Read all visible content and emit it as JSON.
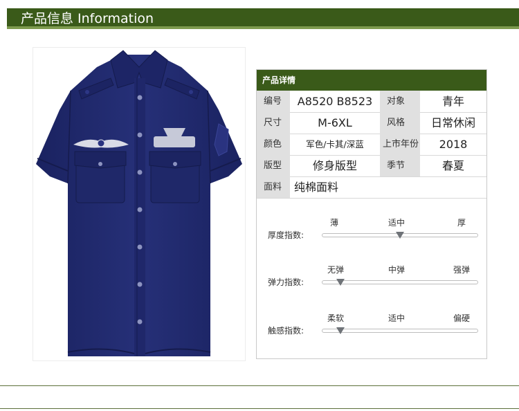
{
  "header": {
    "title": "产品信息 Information"
  },
  "details": {
    "title": "产品详情",
    "rows": [
      {
        "label1": "编号",
        "value1": "A8520 B8523",
        "label2": "对象",
        "value2": "青年"
      },
      {
        "label1": "尺寸",
        "value1": "M-6XL",
        "label2": "风格",
        "value2": "日常休闲"
      },
      {
        "label1": "颜色",
        "value1": "军色/卡其/深蓝",
        "label2": "上市年份",
        "value2": "2018"
      },
      {
        "label1": "版型",
        "value1": "修身版型",
        "label2": "季节",
        "value2": "春夏"
      }
    ],
    "fabric": {
      "label": "面料",
      "value": "纯棉面料"
    }
  },
  "scales": [
    {
      "label": "厚度指数:",
      "options": [
        "薄",
        "适中",
        "厚"
      ],
      "level": 0.5
    },
    {
      "label": "弹力指数:",
      "options": [
        "无弹",
        "中弹",
        "强弹"
      ],
      "level": 0.1
    },
    {
      "label": "触感指数:",
      "options": [
        "柔软",
        "适中",
        "偏硬"
      ],
      "level": 0.1
    }
  ],
  "colors": {
    "brand_green": "#3a5a19",
    "shirt_navy": "#202a6c"
  }
}
